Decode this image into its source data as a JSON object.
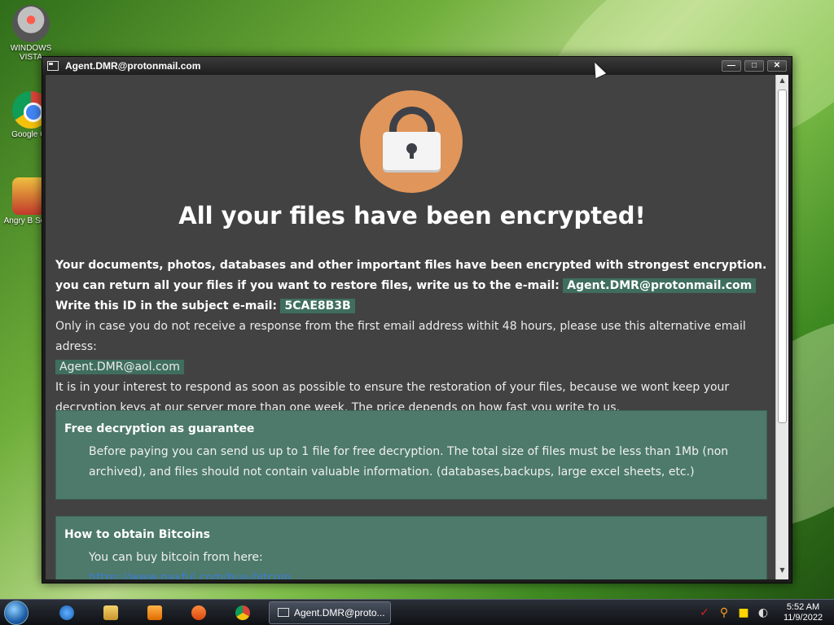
{
  "desktop": {
    "icons": [
      {
        "label": "WINDOWS VISTA"
      },
      {
        "label": "Google Ch"
      },
      {
        "label": "Angry B Seaso"
      }
    ]
  },
  "window": {
    "title": "Agent.DMR@protonmail.com",
    "controls": {
      "minimize": "—",
      "maximize": "□",
      "close": "✕"
    }
  },
  "ransom_note": {
    "headline": "All your files have been encrypted!",
    "para1": "Your documents, photos, databases and other important files have been encrypted with strongest encryption. you can return all your files if you want to restore files, write us to the e-mail:",
    "primary_email": "Agent.DMR@protonmail.com",
    "id_label": "Write this ID in the subject e-mail:",
    "victim_id": "5CAE8B3B",
    "alt_line": "Only in case you do not receive a response from the first email address withit 48 hours, please use this alternative email adress:",
    "alt_email": "Agent.DMR@aol.com",
    "para2": "It is in your interest to respond as soon as possible to ensure the restoration of your files, because we wont keep your decryption keys at our server more than one week. The price depends on how fast you write to us."
  },
  "panels": [
    {
      "title": "Free decryption as guarantee",
      "body": "Before paying you can send us up to 1 file for free decryption. The total size of files must be less than 1Mb (non archived), and files should not contain valuable information. (databases,backups, large excel sheets, etc.)"
    },
    {
      "title": "How to obtain Bitcoins",
      "body": "You can buy bitcoin from here:",
      "link": "https://www.paxful.com/buy-bitcoin"
    }
  ],
  "taskbar": {
    "active_window": "Agent.DMR@proto...",
    "time": "5:52 AM",
    "date": "11/9/2022"
  },
  "colors": {
    "client_bg": "#424242",
    "highlight": "#3f6e5e",
    "panel_bg": "#4d7a6a",
    "lock_circle": "#e0955a"
  }
}
